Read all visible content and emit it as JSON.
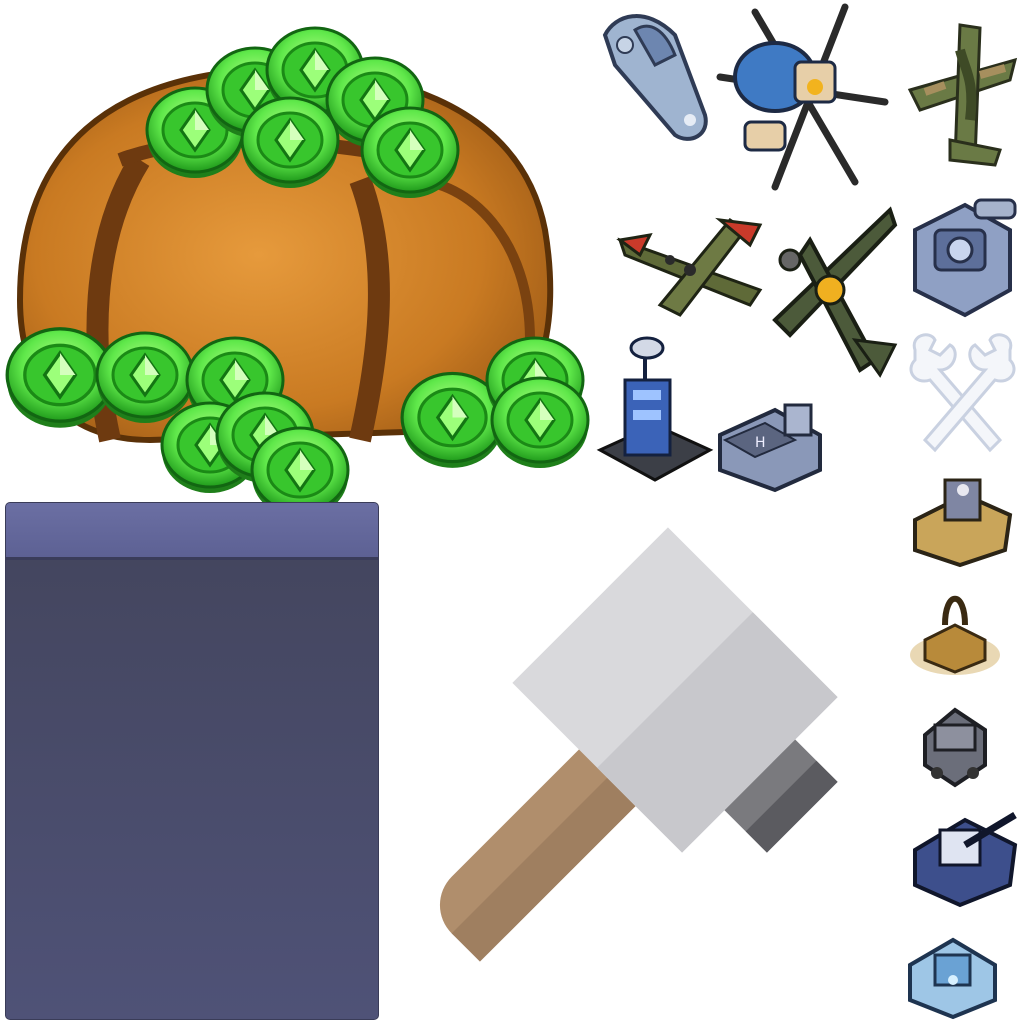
{
  "atlas": {
    "sprites": [
      {
        "name": "gem-coin-bag",
        "type": "currency"
      },
      {
        "name": "submarine",
        "type": "unit"
      },
      {
        "name": "helicopter",
        "type": "unit"
      },
      {
        "name": "camo-bomber",
        "type": "unit"
      },
      {
        "name": "heavy-bomber",
        "type": "unit"
      },
      {
        "name": "fighter-plane",
        "type": "unit"
      },
      {
        "name": "radar-tower",
        "type": "building"
      },
      {
        "name": "helipad",
        "type": "building"
      },
      {
        "name": "defense-turret",
        "type": "building"
      },
      {
        "name": "wrenches",
        "type": "icon"
      },
      {
        "name": "mech-unit",
        "type": "unit"
      },
      {
        "name": "mine-drill",
        "type": "building"
      },
      {
        "name": "supply-truck",
        "type": "unit"
      },
      {
        "name": "blue-tank",
        "type": "unit"
      },
      {
        "name": "fortress",
        "type": "building"
      },
      {
        "name": "hammer",
        "type": "icon"
      }
    ],
    "colors": {
      "gem_green": "#5fe84a",
      "bag_orange": "#c97a22",
      "panel_header": "#6b6fa3",
      "panel_body": "#4b4e72",
      "hammer_head": "#d9d9dc",
      "hammer_handle": "#b08e6c"
    }
  }
}
